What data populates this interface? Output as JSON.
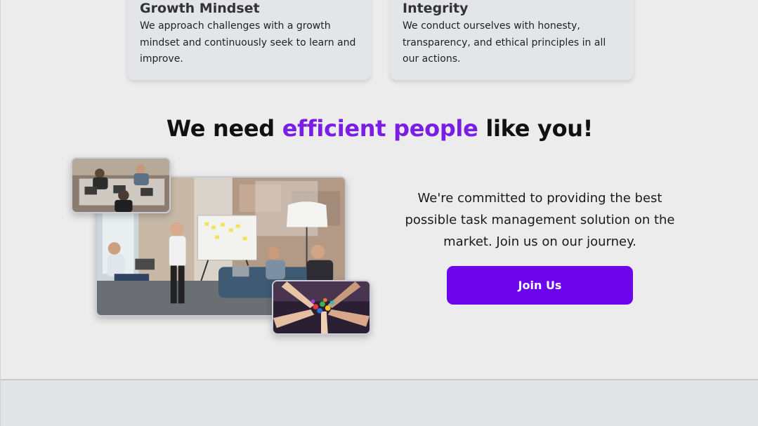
{
  "values_cards": [
    {
      "title": "Growth Mindset",
      "body": "We approach challenges with a growth mindset and continuously seek to learn and improve."
    },
    {
      "title": "Integrity",
      "body": "We conduct ourselves with honesty, transparency, and ethical principles in all our actions."
    }
  ],
  "recruit": {
    "headline_start": "We need",
    "headline_accent": "efficient people",
    "headline_end": "like you!",
    "pitch": "We're committed to providing the best possible task management solution on the market. Join us on our journey.",
    "button_label": "Join Us"
  },
  "colors": {
    "accent": "#7a1ee6",
    "button": "#6c05ec"
  }
}
